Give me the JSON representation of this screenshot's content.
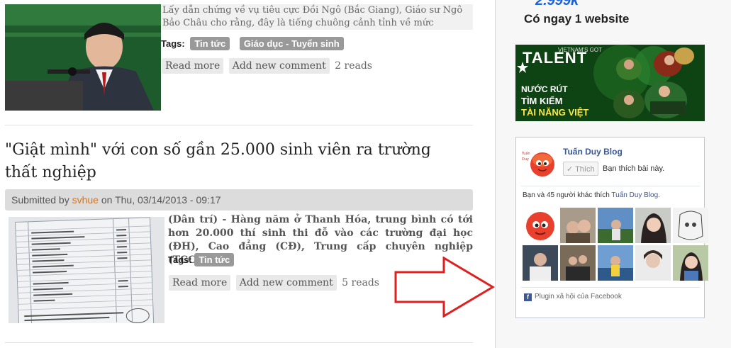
{
  "post1": {
    "teaser": "Lấy dẫn chứng về vụ tiêu cực Đồi Ngô (Bắc Giang), Giáo sư Ngô Bảo Châu cho rằng, đây là tiếng chuông cảnh tỉnh về mức",
    "tags_label": "Tags:",
    "tags": [
      "Tin tức",
      "Giáo dục - Tuyển sinh"
    ],
    "read_more": "Read more",
    "add_comment": "Add new comment",
    "reads": "2 reads"
  },
  "post2": {
    "title": "\"Giật mình\" với con số gần 25.000 sinh viên ra trường thất nghiệp",
    "submitted_prefix": "Submitted by",
    "author": "svhue",
    "submitted_suffix": "on Thu, 03/14/2013 - 09:17",
    "teaser": "(Dân trí) - Hàng năm ở Thanh Hóa, trung bình có tới hơn 20.000 thí sinh thi đỗ vào các trường đại học (ĐH), Cao đẳng (CĐ), Trung cấp chuyên nghiệp (TCCN).",
    "tags_label": "Tags:",
    "tags": [
      "Tin tức"
    ],
    "read_more": "Read more",
    "add_comment": "Add new comment",
    "reads": "5 reads"
  },
  "sidebar": {
    "promo_price": "2.999k",
    "promo_sub": "Có ngay 1 website",
    "talent": {
      "badge": "TALENT",
      "small": "VIETNAM'S GOT",
      "line1": "NƯỚC RÚT",
      "line2": "TÌM KIẾM",
      "line3": "TÀI NĂNG VIỆT"
    },
    "facebook": {
      "page_name": "Tuấn Duy Blog",
      "like_button": "Thích",
      "like_text": "Bạn thích bài này.",
      "count_prefix": "Bạn và 45 người khác thích",
      "count_page": "Tuấn Duy Blog.",
      "footer": "Plugin xã hội của Facebook"
    }
  },
  "colors": {
    "tag_bg": "#999999",
    "author_link": "#d9731b",
    "facebook_blue": "#3b5998",
    "arrow": "#e02020"
  }
}
